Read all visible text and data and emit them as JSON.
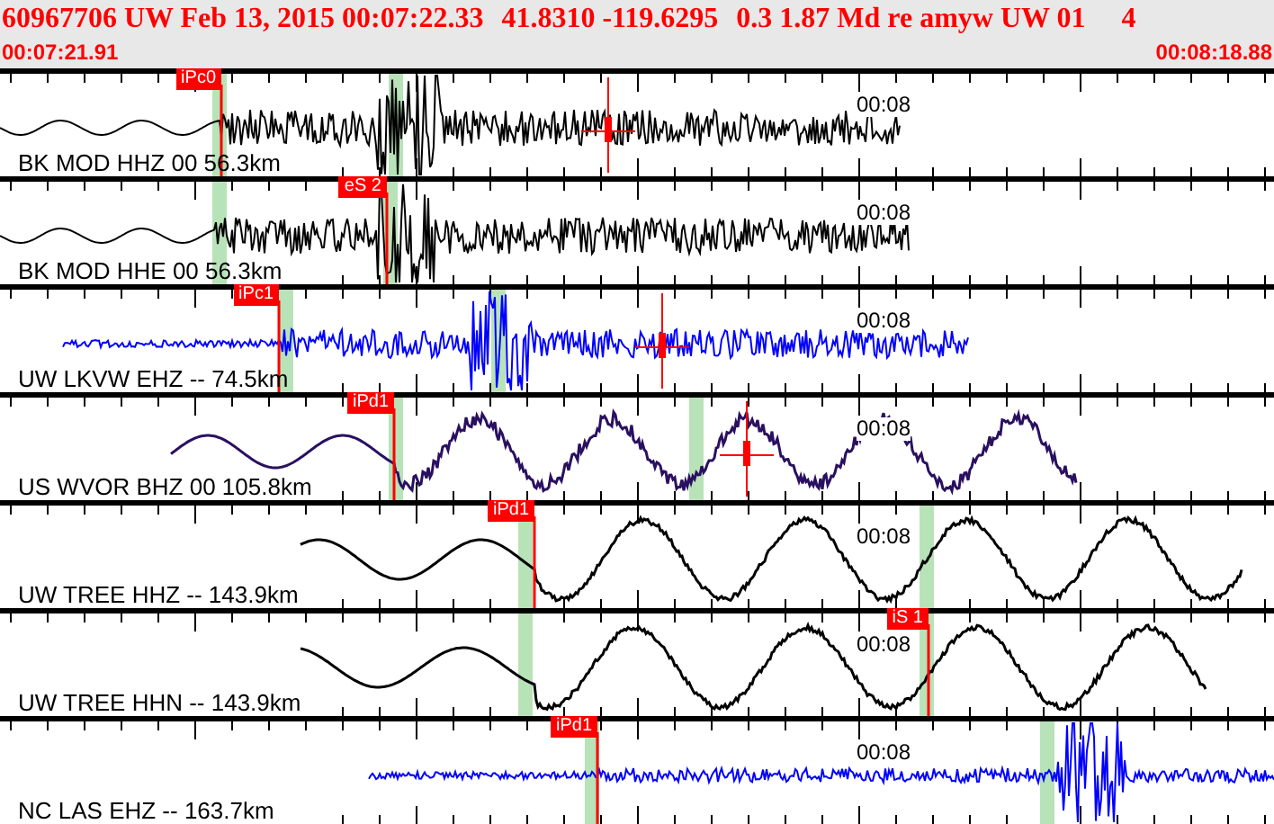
{
  "header": {
    "event": [
      "60967706 UW Feb 13, 2015 00:07:22.33",
      "41.8310 -119.6295",
      "0.3 1.87 Md re amyw UW 01",
      "4"
    ],
    "start_time": "00:07:21.91",
    "end_time": "00:08:18.88"
  },
  "traces": [
    {
      "label": "BK MOD HHZ 00 56.3km",
      "phase": "iPc0",
      "time_label": "00:08",
      "color": "#000000"
    },
    {
      "label": "BK MOD HHE 00 56.3km",
      "phase": "eS 2",
      "time_label": "00:08",
      "color": "#000000"
    },
    {
      "label": "UW LKVW EHZ -- 74.5km",
      "phase": "iPc1",
      "time_label": "00:08",
      "color": "#0000ff"
    },
    {
      "label": "US WVOR BHZ 00 105.8km",
      "phase": "iPd1",
      "time_label": "00:08",
      "color": "#2a1060"
    },
    {
      "label": "UW TREE HHZ -- 143.9km",
      "phase": "iPd1",
      "time_label": "00:08",
      "color": "#000000"
    },
    {
      "label": "UW TREE HHN -- 143.9km",
      "phase": "iS 1",
      "time_label": "00:08",
      "color": "#000000"
    },
    {
      "label": "NC LAS EHZ -- 163.7km",
      "phase": "iPd1",
      "time_label": "00:08",
      "color": "#0000ff"
    }
  ]
}
